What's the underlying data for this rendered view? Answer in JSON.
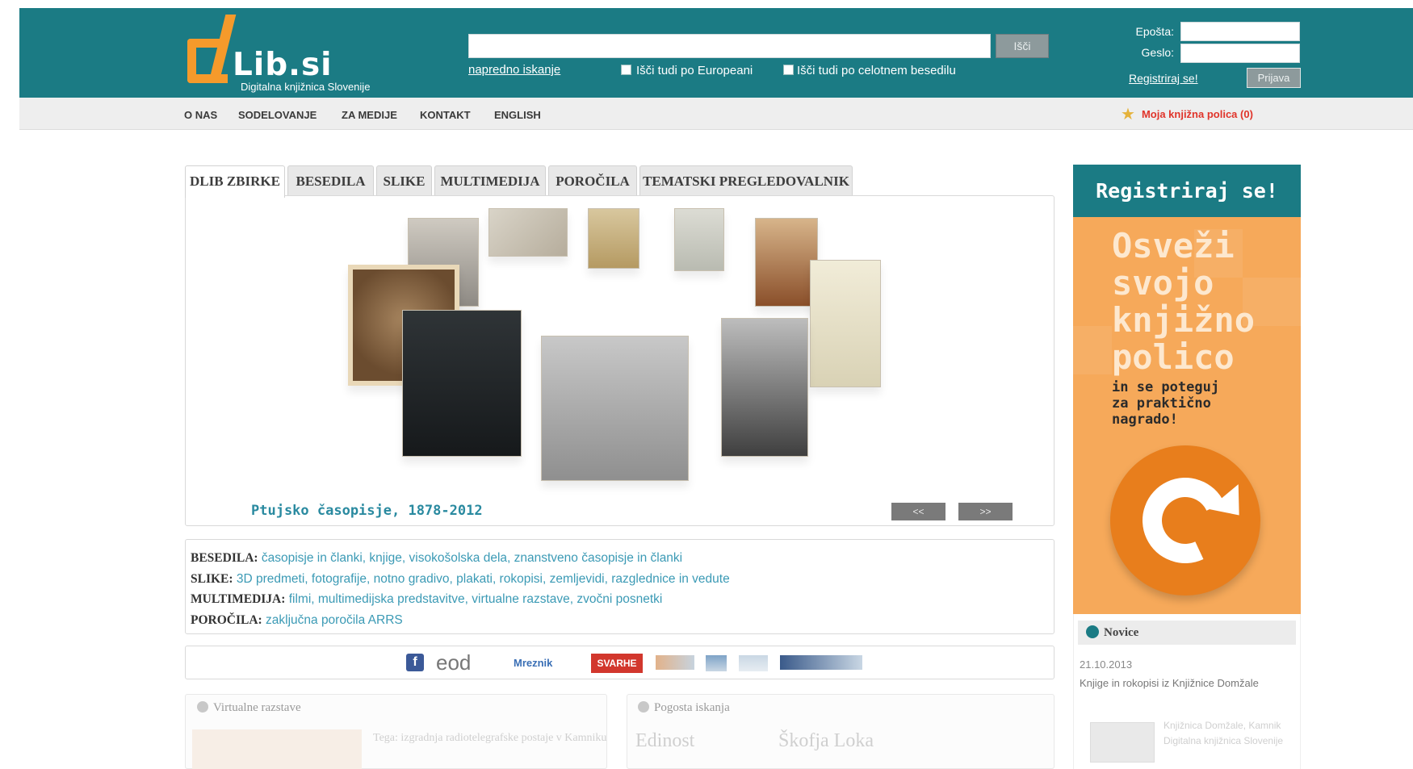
{
  "header": {
    "logo_text": "Lib.si",
    "logo_subtitle": "Digitalna knjižnica Slovenije",
    "search_button": "Išči",
    "advanced_search": "napredno iskanje",
    "option_europeana": "Išči tudi po Europeani",
    "option_fulltext": "Išči tudi po celotnem besedilu",
    "email_label": "Epošta:",
    "password_label": "Geslo:",
    "register_link": "Registriraj se!",
    "login_button": "Prijava"
  },
  "nav": {
    "items": [
      "O NAS",
      "SODELOVANJE",
      "ZA MEDIJE",
      "KONTAKT",
      "ENGLISH"
    ],
    "shelf": "Moja knjižna polica (0)"
  },
  "tabs": [
    "DLIB ZBIRKE",
    "BESEDILA",
    "SLIKE",
    "MULTIMEDIJA",
    "POROČILA",
    "TEMATSKI PREGLEDOVALNIK"
  ],
  "carousel": {
    "caption": "Ptujsko časopisje, 1878-2012",
    "prev": "<<",
    "next": ">>"
  },
  "categories": [
    {
      "label": "BESEDILA:",
      "links": "časopisje in članki, knjige, visokošolska dela, znanstveno časopisje in članki"
    },
    {
      "label": "SLIKE:",
      "links": "3D predmeti, fotografije, notno gradivo, plakati, rokopisi, zemljevidi, razglednice in vedute"
    },
    {
      "label": "MULTIMEDIJA:",
      "links": "filmi, multimedijska predstavitve, virtualne razstave, zvočni posnetki"
    },
    {
      "label": "POROČILA:",
      "links": "zaključna poročila ARRS"
    }
  ],
  "partners": [
    "f",
    "eod",
    "Mreznik",
    "SVARHE"
  ],
  "bottom": {
    "virtual_title": "Virtualne razstave",
    "virtual_text": "Tega: izgradnja radiotelegrafske postaje v Kamniku",
    "frequent_title": "Pogosta iskanja",
    "tags": [
      "Edinost",
      "Škofja Loka"
    ]
  },
  "promo": {
    "header": "Registriraj se!",
    "big_lines": [
      "Osveži",
      "svojo",
      "knjižno",
      "polico"
    ],
    "small_lines": [
      "in se poteguj",
      "za praktično",
      "nagrado!"
    ],
    "accent": "#f6a95a",
    "teal": "#1b7b84"
  },
  "news": {
    "title": "Novice",
    "date": "21.10.2013",
    "headline": "Knjige in rokopisi iz Knjižnice Domžale",
    "snippet": "Knjižnica Domžale, Kamnik Digitalna knjižnica Slovenije"
  },
  "icons": {
    "shelf": "star-icon",
    "refresh": "refresh-icon",
    "news": "circle-bullet-icon"
  }
}
